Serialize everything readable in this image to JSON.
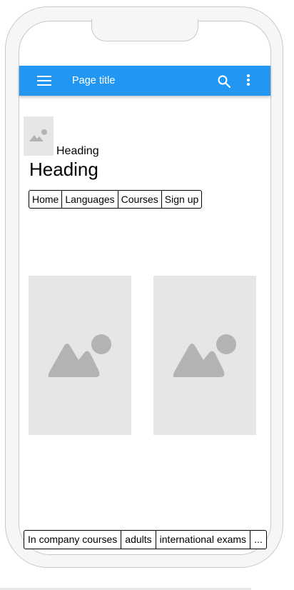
{
  "appbar": {
    "title": "Page title",
    "menu_icon": "menu-icon",
    "search_icon": "search-icon",
    "more_icon": "more-vertical-icon",
    "color": "#2196f3"
  },
  "header": {
    "image_icon": "image-icon",
    "heading_small": "Heading",
    "heading_large": "Heading"
  },
  "nav": {
    "items": [
      "Home",
      "Languages",
      "Courses",
      "Sign up"
    ]
  },
  "gallery": {
    "image_icon": "image-icon"
  },
  "bottom_nav": {
    "items": [
      "In company courses",
      "adults",
      "international exams",
      "..."
    ]
  }
}
